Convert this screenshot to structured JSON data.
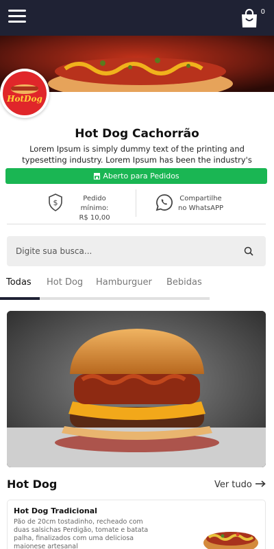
{
  "header": {
    "menu_icon": "hamburger-menu-icon",
    "cart_icon": "shopping-bag-icon",
    "cart_count": "0",
    "bg_color": "#1f2234"
  },
  "store": {
    "logo_text": "HotDog",
    "name": "Hot Dog Cachorrão",
    "description": "Lorem Ipsum is simply dummy text of the printing and typesetting industry. Lorem Ipsum has been the industry's standard dummy"
  },
  "status_button": {
    "label": "Aberto para Pedidos",
    "icon": "store-icon",
    "color": "#1ab653"
  },
  "info": {
    "min_order_label": "Pedido mínimo:",
    "min_order_value": "R$ 10,00",
    "min_order_icon": "shield-dollar-icon",
    "share_label": "Compartilhe",
    "share_sub": "no WhatsAPP",
    "share_icon": "whatsapp-icon"
  },
  "search": {
    "placeholder": "Digite sua busca...",
    "icon": "search-icon"
  },
  "tabs": [
    {
      "label": "Todas",
      "active": true
    },
    {
      "label": "Hot Dog",
      "active": false
    },
    {
      "label": "Hamburguer",
      "active": false
    },
    {
      "label": "Bebidas",
      "active": false
    }
  ],
  "section": {
    "title": "Hot Dog",
    "see_all": "Ver tudo"
  },
  "products": [
    {
      "name": "Hot Dog Tradicional",
      "description": "Pão de 20cm tostadinho, recheado com duas salsichas Perdigão, tomate e batata palha, finalizados com uma deliciosa maionese artesanal"
    }
  ]
}
